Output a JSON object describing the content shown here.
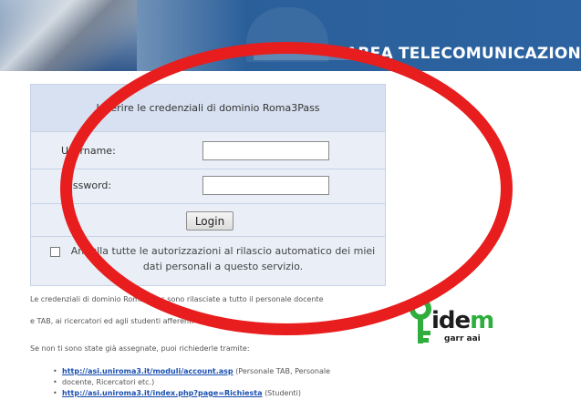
{
  "banner": {
    "title": "AREA TELECOMUNICAZION"
  },
  "login_panel": {
    "header": "Inserire le credenziali di dominio Roma3Pass",
    "username_label": "Username:",
    "password_label": "Password:",
    "username_value": "",
    "password_value": "",
    "login_button": "Login",
    "revoke_checkbox_checked": false,
    "revoke_text_line1": "Annulla tutte le autorizzazioni al rilascio automatico dei miei",
    "revoke_text_line2": "dati personali a questo servizio."
  },
  "info": {
    "line1": "Le credenziali di dominio Roma3Pass sono rilasciate a tutto il personale docente",
    "line2": "e TAB, ai ricercatori ed agli studenti afferenti all'Ateneo.",
    "line3": "Se non ti sono state già assegnate, puoi richiederle tramite:",
    "links": [
      {
        "url": "http://asi.uniroma3.it/moduli/account.asp",
        "desc": "(Personale TAB, Personale"
      },
      {
        "url": "",
        "desc": "docente, Ricercatori etc.)"
      },
      {
        "url": "http://asi.uniroma3.it/index.php?page=Richiesta",
        "desc": "(Studenti)"
      }
    ]
  },
  "logo": {
    "word_prefix": "ide",
    "word_suffix": "m",
    "sub": "garr aai"
  },
  "colors": {
    "banner": "#2a5f9a",
    "panel": "#e9eef7",
    "panel_header": "#d7e1f1",
    "annotation": "#e81d1d",
    "idem_green": "#2fae3e"
  }
}
